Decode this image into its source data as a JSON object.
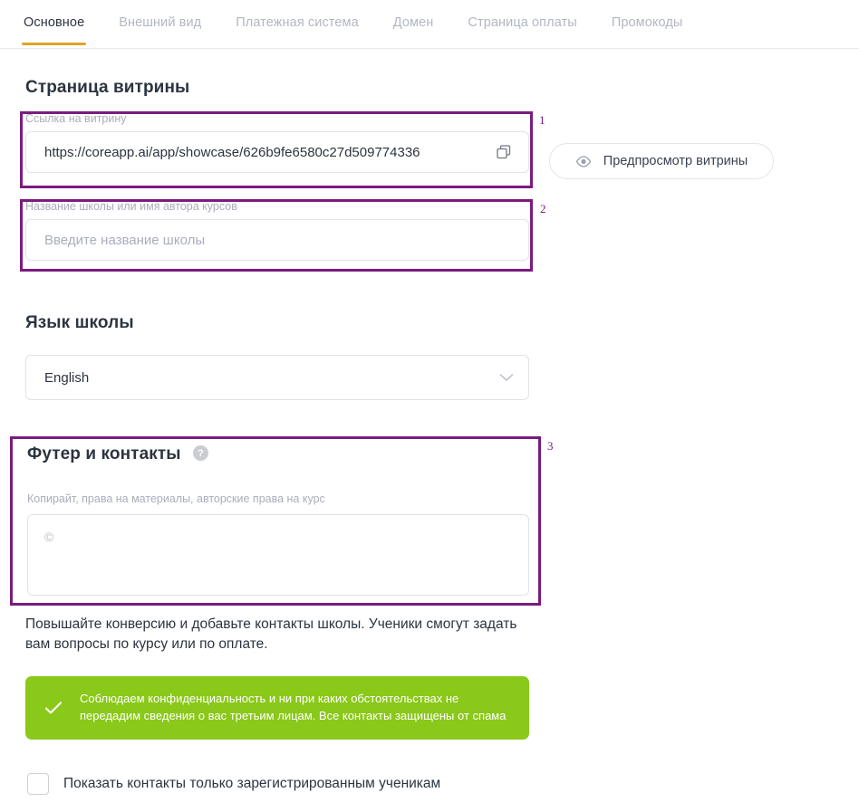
{
  "tabs": [
    {
      "label": "Основное",
      "active": true
    },
    {
      "label": "Внешний вид",
      "active": false
    },
    {
      "label": "Платежная система",
      "active": false
    },
    {
      "label": "Домен",
      "active": false
    },
    {
      "label": "Страница оплаты",
      "active": false
    },
    {
      "label": "Промокоды",
      "active": false
    }
  ],
  "showcase": {
    "section_title": "Страница витрины",
    "url_field": {
      "label": "Ссылка на витрину",
      "value": "https://coreapp.ai/app/showcase/626b9fe6580c27d509774336",
      "copy_icon": "copy-icon"
    },
    "name_field": {
      "label": "Название школы или имя автора курсов",
      "value": "",
      "placeholder": "Введите название школы"
    },
    "preview_button": {
      "label": "Предпросмотр витрины",
      "icon": "eye-icon"
    }
  },
  "language": {
    "section_title": "Язык школы",
    "selected": "English",
    "options": [
      "English"
    ],
    "chevron_icon": "chevron-down-icon"
  },
  "footer": {
    "section_title": "Футер и контакты",
    "help_icon": "question-mark-icon",
    "help_glyph": "?",
    "copyright_label": "Копирайт, права на материалы, авторские права на курс",
    "copyright_value": "©",
    "hint": "Повышайте конверсию и добавьте контакты школы. Ученики смогут задать вам вопросы по курсу или по оплате.",
    "banner": {
      "icon": "check-icon",
      "text": "Соблюдаем конфиденциальность и ни при каких обстоятельствах не передадим сведения о вас третьим лицам. Все контакты защищены от спама",
      "color": "#8ac81a"
    },
    "checkbox": {
      "label": "Показать контакты только зарегистрированным ученикам",
      "checked": false
    }
  },
  "annotations": [
    {
      "number": "1"
    },
    {
      "number": "2"
    },
    {
      "number": "3"
    }
  ],
  "colors": {
    "accent": "#e0a526",
    "annotation": "#7b1b80",
    "success": "#8ac81a"
  }
}
